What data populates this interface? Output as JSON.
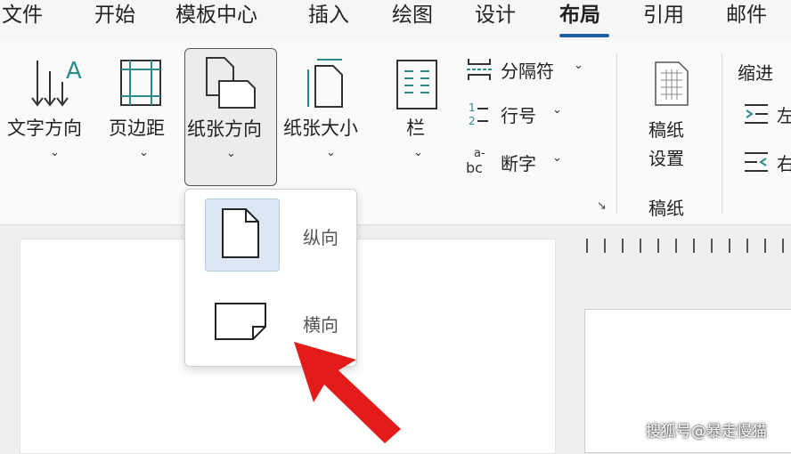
{
  "tabs": [
    {
      "label": "文件"
    },
    {
      "label": "开始"
    },
    {
      "label": "模板中心"
    },
    {
      "label": "插入"
    },
    {
      "label": "绘图"
    },
    {
      "label": "设计"
    },
    {
      "label": "布局",
      "active": true
    },
    {
      "label": "引用"
    },
    {
      "label": "邮件"
    }
  ],
  "ribbon": {
    "text_direction": "文字方向",
    "margins": "页边距",
    "orientation": "纸张方向",
    "size": "纸张大小",
    "columns": "栏",
    "breaks": "分隔符",
    "line_numbers": "行号",
    "hyphenation": "断字",
    "manuscript_setup_line1": "稿纸",
    "manuscript_setup_line2": "设置",
    "manuscript_group": "稿纸",
    "indent_group": "缩进",
    "indent_left": "左",
    "indent_right": "右"
  },
  "orientation_menu": {
    "portrait": "纵向",
    "landscape": "横向",
    "selected": "portrait"
  },
  "watermark": "搜狐号@暴走慢猫",
  "colors": {
    "accent": "#1f5faa",
    "icon_teal": "#2f8c8c",
    "arrow": "#e31b1b"
  }
}
